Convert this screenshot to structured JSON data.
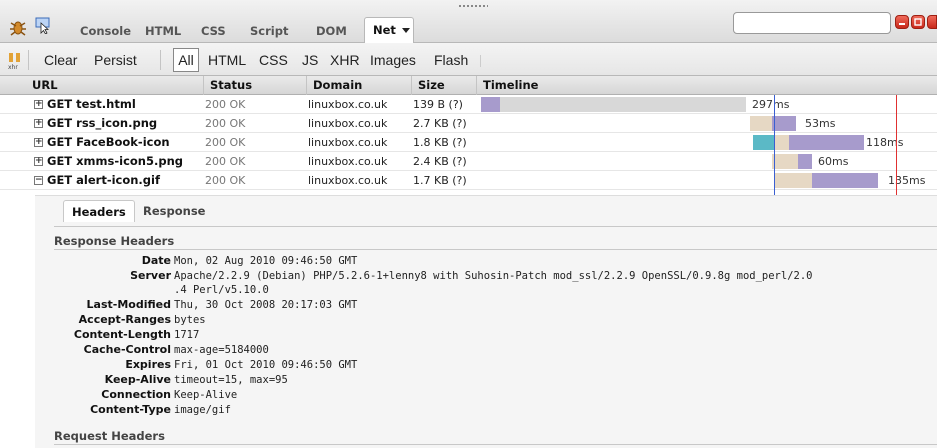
{
  "toolbar": {
    "tabs": [
      "Console",
      "HTML",
      "CSS",
      "Script",
      "DOM"
    ],
    "active_tab": "Net",
    "search_value": ""
  },
  "filterbar": {
    "clear": "Clear",
    "persist": "Persist",
    "filters": [
      "All",
      "HTML",
      "CSS",
      "JS",
      "XHR",
      "Images",
      "Flash"
    ]
  },
  "table": {
    "headers": {
      "url": "URL",
      "status": "Status",
      "domain": "Domain",
      "size": "Size",
      "timeline": "Timeline"
    },
    "rows": [
      {
        "url": "GET test.html",
        "status": "200 OK",
        "domain": "linuxbox.co.uk",
        "size": "139 B (?)",
        "time": "297ms",
        "expander": "+"
      },
      {
        "url": "GET rss_icon.png",
        "status": "200 OK",
        "domain": "linuxbox.co.uk",
        "size": "2.7 KB (?)",
        "time": "53ms",
        "expander": "+"
      },
      {
        "url": "GET FaceBook-icon",
        "status": "200 OK",
        "domain": "linuxbox.co.uk",
        "size": "1.8 KB (?)",
        "time": "118ms",
        "expander": "+"
      },
      {
        "url": "GET xmms-icon5.png",
        "status": "200 OK",
        "domain": "linuxbox.co.uk",
        "size": "2.4 KB (?)",
        "time": "60ms",
        "expander": "+"
      },
      {
        "url": "GET alert-icon.gif",
        "status": "200 OK",
        "domain": "linuxbox.co.uk",
        "size": "1.7 KB (?)",
        "time": "135ms",
        "expander": "−"
      }
    ]
  },
  "details": {
    "tabs": {
      "headers": "Headers",
      "response": "Response"
    },
    "response_title": "Response Headers",
    "request_title": "Request Headers",
    "response_headers": [
      {
        "name": "Date",
        "value": "Mon, 02 Aug 2010 09:46:50 GMT"
      },
      {
        "name": "Server",
        "value": "Apache/2.2.9 (Debian) PHP/5.2.6-1+lenny8 with Suhosin-Patch mod_ssl/2.2.9 OpenSSL/0.9.8g mod_perl/2.0",
        "value2": ".4 Perl/v5.10.0"
      },
      {
        "name": "Last-Modified",
        "value": "Thu, 30 Oct 2008 20:17:03 GMT"
      },
      {
        "name": "Accept-Ranges",
        "value": "bytes"
      },
      {
        "name": "Content-Length",
        "value": "1717"
      },
      {
        "name": "Cache-Control",
        "value": "max-age=5184000"
      },
      {
        "name": "Expires",
        "value": "Fri, 01 Oct 2010 09:46:50 GMT"
      },
      {
        "name": "Keep-Alive",
        "value": "timeout=15, max=95"
      },
      {
        "name": "Connection",
        "value": "Keep-Alive"
      },
      {
        "name": "Content-Type",
        "value": "image/gif"
      }
    ]
  },
  "colors": {
    "bar_receiving": "#a79bcc",
    "bar_waiting": "#e6d8c4",
    "bar_connecting": "#5bb9c6",
    "dom_ready_line": "#3b5fd1",
    "load_line": "#e03030"
  }
}
